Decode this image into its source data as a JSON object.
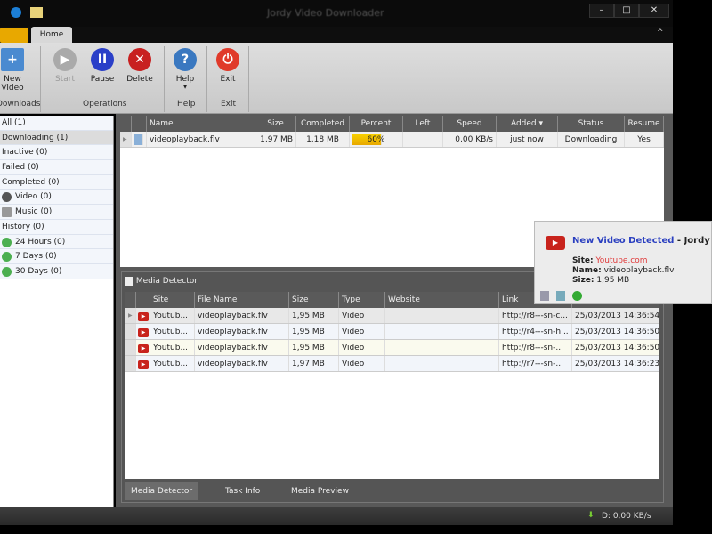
{
  "window": {
    "title": "Jordy Video Downloader",
    "controls": [
      "–",
      "□",
      "✕"
    ]
  },
  "ribbon": {
    "tab": "Home",
    "buttons": {
      "new_video": "New Video",
      "start": "Start",
      "pause": "Pause",
      "delete": "Delete",
      "help": "Help",
      "exit": "Exit"
    },
    "groups": {
      "downloads": "Downloads",
      "operations": "Operations",
      "help": "Help",
      "exit": "Exit"
    }
  },
  "sidebar": {
    "items": [
      {
        "label": "All (1)"
      },
      {
        "label": "Downloading (1)"
      },
      {
        "label": "Inactive (0)"
      },
      {
        "label": "Failed (0)"
      },
      {
        "label": "Completed (0)"
      },
      {
        "label": "Video (0)"
      },
      {
        "label": "Music (0)"
      },
      {
        "label": "History (0)"
      },
      {
        "label": "24 Hours (0)"
      },
      {
        "label": "7 Days (0)"
      },
      {
        "label": "30 Days (0)"
      }
    ]
  },
  "downloads": {
    "columns": [
      "Name",
      "Size",
      "Completed",
      "Percent",
      "Left",
      "Speed",
      "Added",
      "Status",
      "Resume"
    ],
    "rows": [
      {
        "name": "videoplayback.flv",
        "size": "1,97 MB",
        "completed": "1,18 MB",
        "percent": "60%",
        "percent_value": 60,
        "left": "",
        "speed": "0,00 KB/s",
        "added": "just now",
        "status": "Downloading",
        "resume": "Yes"
      }
    ]
  },
  "media_detector": {
    "title": "Media Detector",
    "columns": [
      "Site",
      "File Name",
      "Size",
      "Type",
      "Website",
      "Link",
      ""
    ],
    "rows": [
      {
        "site": "Youtub...",
        "file": "videoplayback.flv",
        "size": "1,95 MB",
        "type": "Video",
        "website": "",
        "link": "http://r8---sn-c...",
        "date": "25/03/2013 14:36:54"
      },
      {
        "site": "Youtub...",
        "file": "videoplayback.flv",
        "size": "1,95 MB",
        "type": "Video",
        "website": "",
        "link": "http://r4---sn-h...",
        "date": "25/03/2013 14:36:50"
      },
      {
        "site": "Youtub...",
        "file": "videoplayback.flv",
        "size": "1,95 MB",
        "type": "Video",
        "website": "",
        "link": "http://r8---sn-...",
        "date": "25/03/2013 14:36:50"
      },
      {
        "site": "Youtub...",
        "file": "videoplayback.flv",
        "size": "1,97 MB",
        "type": "Video",
        "website": "",
        "link": "http://r7---sn-...",
        "date": "25/03/2013 14:36:23"
      }
    ]
  },
  "bottom_tabs": [
    "Media Detector",
    "Task Info",
    "Media Preview"
  ],
  "popup": {
    "title": "New Video Detected",
    "app": " - Jordy V",
    "site_label": "Site:",
    "site": "Youtube.com",
    "name_label": "Name:",
    "name": "videoplayback.flv",
    "size_label": "Size:",
    "size": "1,95 MB"
  },
  "statusbar": {
    "speed": "D: 0,00 KB/s"
  },
  "colors": {
    "accent": "#e8a800",
    "popup_title": "#2a3fc0",
    "site_link": "#e03a3a",
    "progress": "#f0c000"
  }
}
